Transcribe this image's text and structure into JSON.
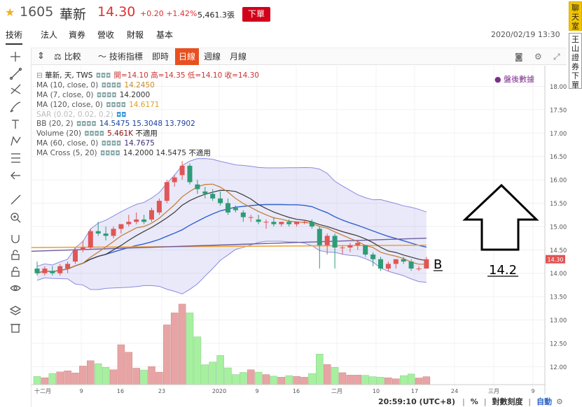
{
  "header": {
    "star_icon": "star-icon",
    "code": "1605",
    "name": "華新",
    "price": "14.30",
    "change": "+0.20 +1.42%",
    "volume": "5,461.3張",
    "order_button": "下單"
  },
  "tabs": [
    "技術",
    "法人",
    "資券",
    "營收",
    "財報",
    "基本"
  ],
  "datetime": "2020/02/19 13:30",
  "side_buttons": [
    "聊天室",
    "王山證券下單"
  ],
  "toolbar": {
    "compare": "比較",
    "indicators": "技術指標",
    "realtime": "即時",
    "daily": "日線",
    "weekly": "週線",
    "monthly": "月線"
  },
  "legend": {
    "title": "華新, 天, TWS",
    "ohlc": "開=14.10  高=14.35  低=14.10  收=14.30",
    "ma10_label": "MA (10, close, 0)",
    "ma10_val": "14.2450",
    "ma7_label": "MA (7, close, 0)",
    "ma7_val": "14.2000",
    "ma120_label": "MA (120, close, 0)",
    "ma120_val": "14.6171",
    "sar_label": "SAR (0.02, 0.02, 0.2)",
    "bb_label": "BB (20, 2)",
    "bb_vals": "14.5475  15.3048  13.7902",
    "vol_label": "Volume (20)",
    "vol_val": "5.461K",
    "vol_na": "不適用",
    "ma60_label": "MA (60, close, 0)",
    "ma60_val": "14.7675",
    "cross_label": "MA Cross (5, 20)",
    "cross_vals": "14.2000  14.5475",
    "cross_na": "不適用"
  },
  "badge": "盤後數據",
  "annotation": {
    "b_label": "B",
    "arrow_value": "14.2"
  },
  "status_bar": {
    "time": "20:59:10 (UTC+8)",
    "percent": "%",
    "log": "對數刻度",
    "auto": "自動"
  },
  "colors": {
    "up": "#e05555",
    "down": "#2e9c76",
    "vol_up": "#e8a4a4",
    "vol_down": "#a6f0a0",
    "ma10": "#3a3a3a",
    "ma7": "#c47a2e",
    "ma120": "#f0a33c",
    "ma60": "#6d5da0",
    "bb": "#3060d0"
  },
  "chart_data": {
    "type": "candlestick",
    "y_ticks": [
      "18.00",
      "17.50",
      "17.00",
      "16.50",
      "16.00",
      "15.50",
      "15.00",
      "14.50",
      "14.00",
      "13.50",
      "13.00",
      "12.50",
      "12.00"
    ],
    "last_price_label": "14.30",
    "x_ticks": [
      "十二月",
      "9",
      "16",
      "23",
      "2020",
      "9",
      "16",
      "二月",
      "10",
      "17",
      "24",
      "三月",
      "9"
    ],
    "ohlc": [
      [
        14.1,
        14.25,
        13.95,
        14.0
      ],
      [
        14.0,
        14.15,
        13.95,
        14.1
      ],
      [
        14.05,
        14.15,
        13.95,
        14.0
      ],
      [
        14.0,
        14.2,
        13.95,
        14.15
      ],
      [
        14.1,
        14.25,
        14.0,
        14.2
      ],
      [
        14.25,
        14.55,
        14.2,
        14.5
      ],
      [
        14.5,
        14.7,
        14.45,
        14.55
      ],
      [
        14.55,
        14.95,
        14.5,
        14.9
      ],
      [
        14.9,
        15.1,
        14.8,
        14.85
      ],
      [
        14.85,
        15.0,
        14.7,
        14.8
      ],
      [
        14.8,
        15.0,
        14.75,
        14.95
      ],
      [
        14.95,
        15.05,
        14.85,
        15.05
      ],
      [
        15.05,
        15.25,
        15.0,
        15.1
      ],
      [
        15.1,
        15.3,
        15.05,
        15.15
      ],
      [
        15.15,
        15.25,
        15.05,
        15.1
      ],
      [
        15.15,
        15.4,
        15.1,
        15.35
      ],
      [
        15.3,
        15.6,
        15.25,
        15.55
      ],
      [
        15.55,
        16.0,
        15.5,
        15.95
      ],
      [
        15.95,
        16.1,
        15.85,
        16.05
      ],
      [
        16.1,
        16.4,
        16.0,
        16.3
      ],
      [
        16.3,
        16.35,
        15.9,
        15.95
      ],
      [
        15.9,
        16.0,
        15.7,
        15.8
      ],
      [
        15.75,
        15.85,
        15.6,
        15.7
      ],
      [
        15.7,
        15.8,
        15.55,
        15.6
      ],
      [
        15.6,
        15.75,
        15.45,
        15.5
      ],
      [
        15.5,
        15.6,
        15.25,
        15.3
      ],
      [
        15.4,
        15.45,
        15.3,
        15.35
      ],
      [
        15.3,
        15.35,
        15.1,
        15.2
      ],
      [
        15.2,
        15.25,
        15.1,
        15.2
      ],
      [
        15.15,
        15.25,
        15.05,
        15.1
      ],
      [
        15.1,
        15.15,
        14.95,
        15.1
      ],
      [
        15.1,
        15.2,
        15.0,
        15.05
      ],
      [
        15.05,
        15.1,
        15.0,
        15.1
      ],
      [
        15.1,
        15.15,
        15.0,
        15.05
      ],
      [
        15.05,
        15.1,
        15.0,
        15.1
      ],
      [
        15.1,
        15.15,
        15.05,
        15.1
      ],
      [
        15.1,
        15.15,
        14.95,
        15.0
      ],
      [
        14.95,
        15.0,
        14.1,
        14.6
      ],
      [
        14.6,
        14.85,
        14.4,
        14.8
      ],
      [
        14.8,
        14.85,
        14.1,
        14.55
      ],
      [
        14.55,
        14.6,
        14.4,
        14.55
      ],
      [
        14.55,
        14.65,
        14.45,
        14.6
      ],
      [
        14.6,
        14.7,
        14.5,
        14.65
      ],
      [
        14.6,
        14.6,
        14.35,
        14.4
      ],
      [
        14.4,
        14.45,
        14.15,
        14.3
      ],
      [
        14.3,
        14.35,
        14.05,
        14.1
      ],
      [
        14.1,
        14.25,
        14.05,
        14.2
      ],
      [
        14.2,
        14.3,
        14.1,
        14.3
      ],
      [
        14.3,
        14.35,
        14.2,
        14.25
      ],
      [
        14.25,
        14.3,
        14.05,
        14.1
      ],
      [
        14.1,
        14.15,
        14.05,
        14.1
      ],
      [
        14.1,
        14.35,
        14.1,
        14.3
      ]
    ],
    "volume_lots": [
      310,
      260,
      420,
      480,
      520,
      440,
      700,
      900,
      790,
      650,
      560,
      1500,
      1220,
      620,
      550,
      680,
      470,
      2250,
      2700,
      3030,
      2700,
      1800,
      750,
      850,
      1100,
      630,
      380,
      460,
      560,
      470,
      380,
      320,
      280,
      340,
      310,
      280,
      420,
      1150,
      760,
      650,
      450,
      360,
      360,
      350,
      300,
      280,
      260,
      220,
      340,
      400,
      250,
      300
    ]
  }
}
